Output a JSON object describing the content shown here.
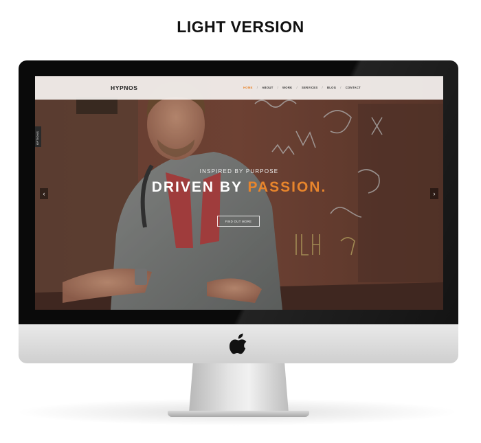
{
  "heading": "LIGHT VERSION",
  "site": {
    "logo": "HYPNOS",
    "nav": [
      "HOME",
      "ABOUT",
      "WORK",
      "SERVICES",
      "BLOG",
      "CONTACT"
    ],
    "nav_separator": "/",
    "options_tab": "OPTIONS"
  },
  "hero": {
    "subtitle": "INSPIRED BY PURPOSE",
    "headline_main": "DRIVEN BY ",
    "headline_accent": "PASSION.",
    "cta_label": "FIND OUT MORE",
    "prev_arrow": "‹",
    "next_arrow": "›"
  },
  "colors": {
    "accent": "#e8852c",
    "navbar": "#f5f2f0",
    "bezel": "#0a0a0a"
  },
  "icons": [
    "apple-icon",
    "chevron-left-icon",
    "chevron-right-icon"
  ]
}
